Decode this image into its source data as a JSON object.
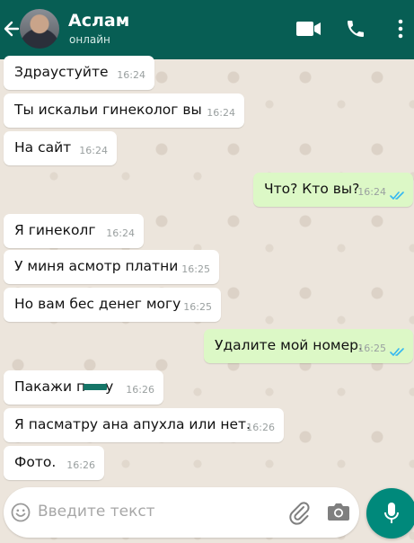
{
  "header": {
    "contact_name": "Аслам",
    "status": "онлайн"
  },
  "messages": [
    {
      "text": "Здраустуйте",
      "time": "16:24",
      "direction": "in"
    },
    {
      "text": "Ты искальи гинеколог вы",
      "time": "16:24",
      "direction": "in"
    },
    {
      "text": "На сайт",
      "time": "16:24",
      "direction": "in"
    },
    {
      "text": "Что? Кто вы?",
      "time": "16:24",
      "direction": "out",
      "status": "read"
    },
    {
      "text": "Я гинеколг",
      "time": "16:24",
      "direction": "in"
    },
    {
      "text": "У миня асмотр платни",
      "time": "16:25",
      "direction": "in"
    },
    {
      "text": "Но вам бес денег могу",
      "time": "16:25",
      "direction": "in"
    },
    {
      "text": "Удалите мой номер.",
      "time": "16:25",
      "direction": "out",
      "status": "read"
    },
    {
      "text_before": "Пакажи п",
      "text_after": "у",
      "time": "16:26",
      "direction": "in",
      "redacted": true
    },
    {
      "text": "Я пасматру ана апухла или нет.",
      "time": "16:26",
      "direction": "in"
    },
    {
      "text": "Фото.",
      "time": "16:26",
      "direction": "in"
    }
  ],
  "input": {
    "placeholder": "Введите текст"
  },
  "colors": {
    "header": "#075e54",
    "outgoing_bubble": "#dcf8c6",
    "incoming_bubble": "#ffffff",
    "read_ticks": "#34b7f1",
    "mic_button": "#00897b"
  },
  "icons": [
    "back-arrow-icon",
    "video-call-icon",
    "phone-icon",
    "more-vert-icon",
    "emoji-icon",
    "attach-icon",
    "camera-icon",
    "mic-icon"
  ]
}
